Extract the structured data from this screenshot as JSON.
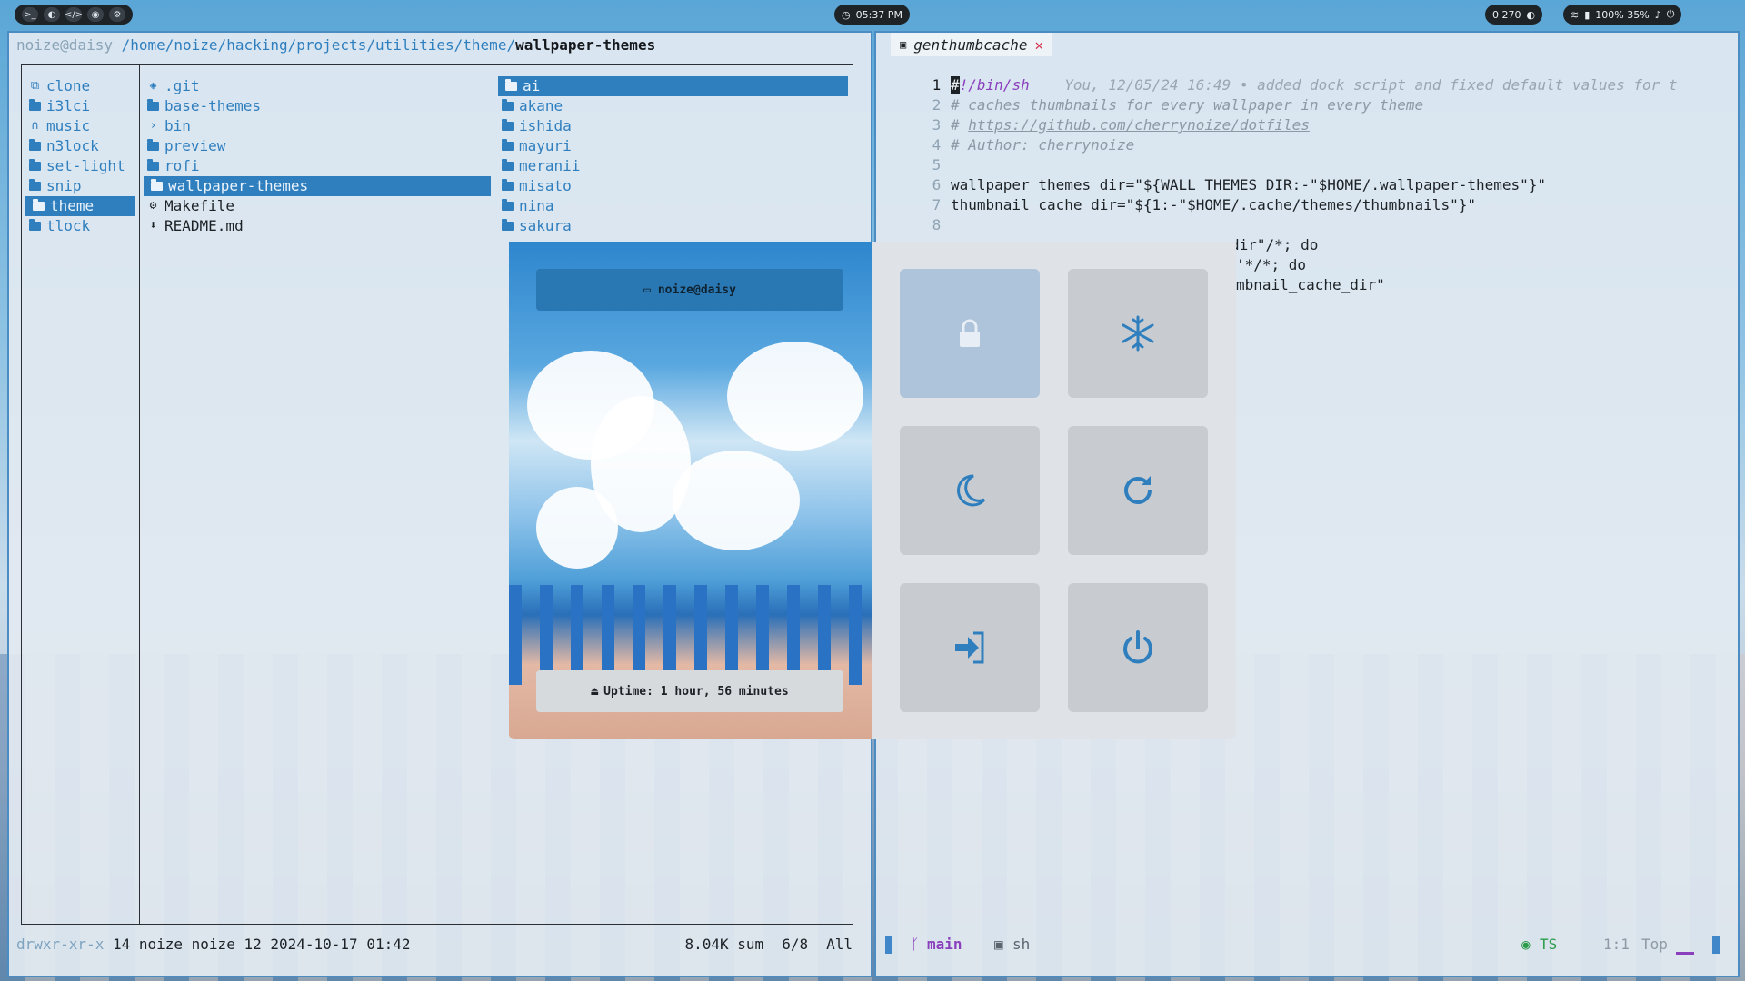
{
  "topbar": {
    "workspace_icons": [
      "terminal-icon",
      "moon-icon",
      "code-icon",
      "chat-icon",
      "gear-icon"
    ],
    "clock": "05:37 PM",
    "notif": "0 270",
    "system": "100%  35%"
  },
  "file_manager": {
    "path_user": "noize@daisy",
    "path_dir": " /home/noize/hacking/projects/utilities/theme/",
    "path_current": "wallpaper-themes",
    "col1": [
      "clone",
      "i3lci",
      "music",
      "n3lock",
      "set-light",
      "snip",
      "theme",
      "tlock"
    ],
    "col2": [
      ".git",
      "base-themes",
      "bin",
      "preview",
      "rofi",
      "wallpaper-themes",
      "Makefile",
      "README.md"
    ],
    "col3": [
      "ai",
      "akane",
      "ishida",
      "mayuri",
      "meranii",
      "misato",
      "nina",
      "sakura"
    ],
    "status_perm": "drwxr-xr-x",
    "status_info": " 14 noize noize 12 2024-10-17 01:42",
    "status_size": "8.04K sum",
    "status_pos": "6/8",
    "status_all": "All"
  },
  "editor": {
    "tab_title": "genthumbcache",
    "line_numbers": [
      "1",
      "2",
      "3",
      "4",
      "5",
      "6",
      "7",
      "8"
    ],
    "line1_hash": "#",
    "line1_rest": "!/bin/sh",
    "blame": "You, 12/05/24 16:49 • added dock script and fixed default values for t",
    "line2": "# caches thumbnails for every wallpaper in every theme",
    "line3_hash": "# ",
    "line3_link": "https://github.com/cherrynoize/dotfiles",
    "line4": "# Author: cherrynoize",
    "line6": "wallpaper_themes_dir=\"${WALL_THEMES_DIR:-\"$HOME/.wallpaper-themes\"}\"",
    "line7": "thumbnail_cache_dir=\"${1:-\"$HOME/.cache/themes/thumbnails\"}\"",
    "line9_tail": "dir\"/*; do",
    "line10_tail": "'*/*; do",
    "line11_tail": "mbnail_cache_dir\"",
    "status_branch": "main",
    "status_shell": "sh",
    "status_ts": "TS",
    "status_pos": "1:1",
    "status_top": "Top"
  },
  "power_menu": {
    "user": "noize@daisy",
    "uptime": "Uptime: 1 hour, 56 minutes",
    "buttons": [
      "lock-icon",
      "freeze-icon",
      "suspend-icon",
      "reboot-icon",
      "logout-icon",
      "power-icon"
    ]
  }
}
